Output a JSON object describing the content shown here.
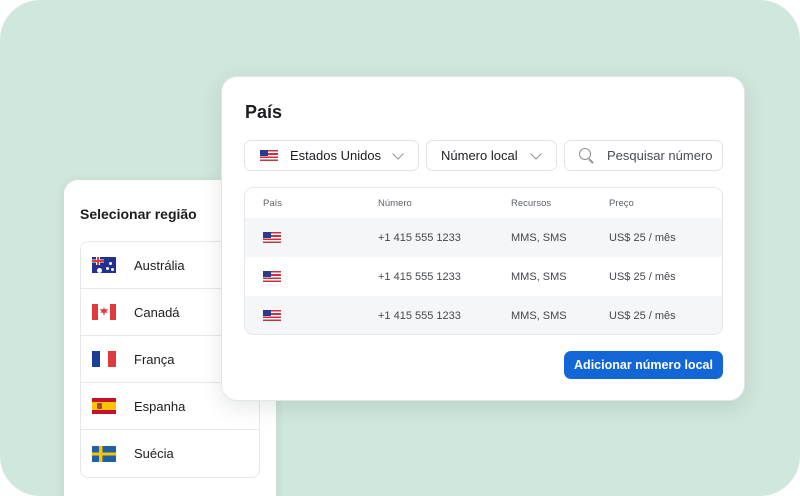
{
  "region_panel": {
    "title": "Selecionar região",
    "items": [
      {
        "label": "Austrália",
        "flag": "australia-flag-icon"
      },
      {
        "label": "Canadá",
        "flag": "canada-flag-icon"
      },
      {
        "label": "França",
        "flag": "france-flag-icon"
      },
      {
        "label": "Espanha",
        "flag": "spain-flag-icon"
      },
      {
        "label": "Suécia",
        "flag": "sweden-flag-icon"
      }
    ]
  },
  "main_panel": {
    "title": "País",
    "country_select": {
      "value": "Estados Unidos",
      "flag": "usa-flag-icon"
    },
    "type_select": {
      "value": "Número local"
    },
    "search": {
      "placeholder": "Pesquisar número",
      "icon": "search-icon"
    },
    "table": {
      "columns": [
        "País",
        "Número",
        "Recursos",
        "Preço"
      ],
      "rows": [
        {
          "flag": "usa-flag-icon",
          "number": "+1 415 555 1233",
          "features": "MMS, SMS",
          "price": "US$ 25 / mês"
        },
        {
          "flag": "usa-flag-icon",
          "number": "+1 415 555 1233",
          "features": "MMS, SMS",
          "price": "US$ 25 / mês"
        },
        {
          "flag": "usa-flag-icon",
          "number": "+1 415 555 1233",
          "features": "MMS, SMS",
          "price": "US$ 25 / mês"
        }
      ]
    },
    "add_button": "Adicionar número local"
  },
  "colors": {
    "background": "#d0e7dc",
    "primary": "#1266d6",
    "row_alt": "#f5f6f8",
    "border": "#e6e8eb"
  }
}
